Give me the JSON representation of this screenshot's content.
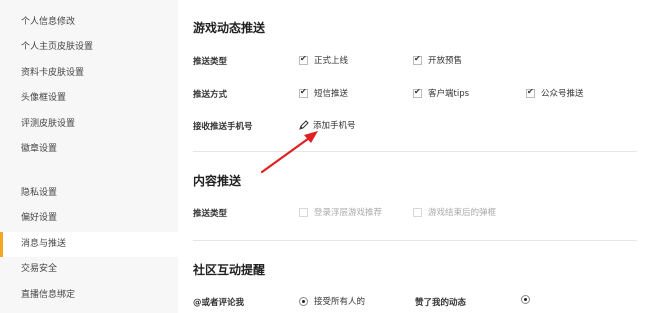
{
  "sidebar": {
    "group1": [
      {
        "label": "个人信息修改"
      },
      {
        "label": "个人主页皮肤设置"
      },
      {
        "label": "资料卡皮肤设置"
      },
      {
        "label": "头像框设置"
      },
      {
        "label": "评测皮肤设置"
      },
      {
        "label": "徽章设置"
      }
    ],
    "group2": [
      {
        "label": "隐私设置"
      },
      {
        "label": "偏好设置"
      },
      {
        "label": "消息与推送",
        "active": true
      },
      {
        "label": "交易安全"
      },
      {
        "label": "直播信息绑定"
      }
    ],
    "active_color": "#f5a623"
  },
  "game_push": {
    "title": "游戏动态推送",
    "type_label": "推送类型",
    "type_options": [
      {
        "label": "正式上线",
        "checked": true
      },
      {
        "label": "开放预售",
        "checked": true
      }
    ],
    "method_label": "推送方式",
    "method_options": [
      {
        "label": "短信推送",
        "checked": true
      },
      {
        "label": "客户端tips",
        "checked": true
      },
      {
        "label": "公众号推送",
        "checked": true
      }
    ],
    "phone_label": "接收推送手机号",
    "add_phone_label": "添加手机号",
    "add_phone_icon": "pencil-icon",
    "arrow_color": "#e02020"
  },
  "content_push": {
    "title": "内容推送",
    "type_label": "推送类型",
    "type_options": [
      {
        "label": "登录浮层游戏推荐",
        "checked": false
      },
      {
        "label": "游戏结束后的弹框",
        "checked": false
      }
    ]
  },
  "community": {
    "title": "社区互动提醒",
    "mention_label": "@或者评论我",
    "mention_option": "接受所有人的",
    "liked_label": "赞了我的动态"
  }
}
